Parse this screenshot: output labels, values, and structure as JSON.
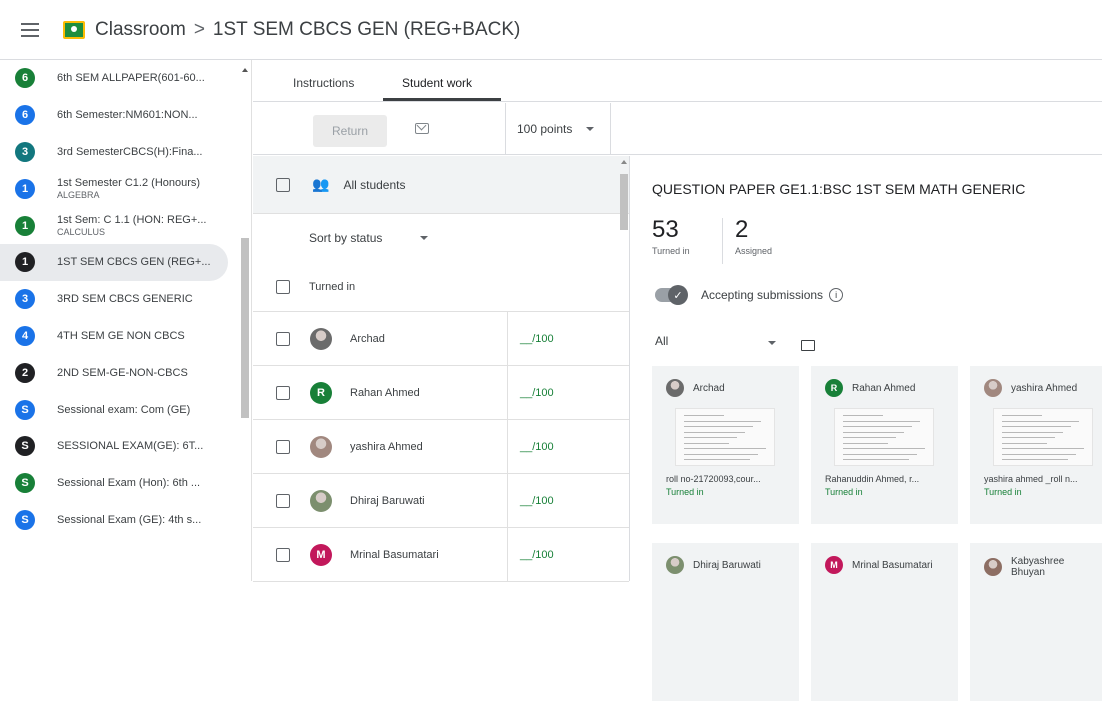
{
  "header": {
    "app_name": "Classroom",
    "separator": ">",
    "class_name": "1ST SEM CBCS GEN (REG+BACK)"
  },
  "sidebar": {
    "items": [
      {
        "badge": "6",
        "color": "#188038",
        "label": "6th SEM ALLPAPER(601-60...",
        "sub": ""
      },
      {
        "badge": "6",
        "color": "#1a73e8",
        "label": "6th Semester:NM601:NON...",
        "sub": ""
      },
      {
        "badge": "3",
        "color": "#12777e",
        "label": "3rd SemesterCBCS(H):Fina...",
        "sub": ""
      },
      {
        "badge": "1",
        "color": "#1a73e8",
        "label": "1st Semester C1.2 (Honours)",
        "sub": "ALGEBRA"
      },
      {
        "badge": "1",
        "color": "#188038",
        "label": "1st Sem: C 1.1 (HON: REG+...",
        "sub": "CALCULUS"
      },
      {
        "badge": "1",
        "color": "#202124",
        "label": "1ST SEM CBCS GEN (REG+...",
        "sub": "",
        "active": true
      },
      {
        "badge": "3",
        "color": "#1a73e8",
        "label": "3RD SEM CBCS GENERIC",
        "sub": ""
      },
      {
        "badge": "4",
        "color": "#1a73e8",
        "label": "4TH SEM GE NON CBCS",
        "sub": ""
      },
      {
        "badge": "2",
        "color": "#202124",
        "label": "2ND SEM-GE-NON-CBCS",
        "sub": ""
      },
      {
        "badge": "S",
        "color": "#1a73e8",
        "label": "Sessional exam: Com (GE)",
        "sub": ""
      },
      {
        "badge": "S",
        "color": "#202124",
        "label": "SESSIONAL EXAM(GE): 6T...",
        "sub": ""
      },
      {
        "badge": "S",
        "color": "#188038",
        "label": "Sessional Exam (Hon): 6th ...",
        "sub": ""
      },
      {
        "badge": "S",
        "color": "#1a73e8",
        "label": "Sessional Exam (GE): 4th s...",
        "sub": ""
      }
    ]
  },
  "tabs": {
    "instructions": "Instructions",
    "student_work": "Student work"
  },
  "toolbar": {
    "return_label": "Return",
    "points": "100 points"
  },
  "list": {
    "all_students": "All students",
    "sort_label": "Sort by status",
    "group_label": "Turned in",
    "students": [
      {
        "name": "Archad",
        "grade": "__/100",
        "avatar": "photo",
        "color": "#6b6b6b",
        "initial": ""
      },
      {
        "name": "Rahan Ahmed",
        "grade": "__/100",
        "avatar": "letter",
        "color": "#188038",
        "initial": "R"
      },
      {
        "name": "yashira Ahmed",
        "grade": "__/100",
        "avatar": "photo",
        "color": "#a1887f",
        "initial": ""
      },
      {
        "name": "Dhiraj Baruwati",
        "grade": "__/100",
        "avatar": "photo",
        "color": "#7c8f6e",
        "initial": ""
      },
      {
        "name": "Mrinal Basumatari",
        "grade": "__/100",
        "avatar": "letter",
        "color": "#c2185b",
        "initial": "M"
      }
    ]
  },
  "detail": {
    "title": "QUESTION PAPER GE1.1:BSC 1ST SEM MATH GENERIC",
    "turned_in_count": "53",
    "turned_in_label": "Turned in",
    "assigned_count": "2",
    "assigned_label": "Assigned",
    "accepting_label": "Accepting submissions",
    "filter_label": "All",
    "cards": [
      {
        "name": "Archad",
        "caption": "roll no-21720093,cour...",
        "status": "Turned in",
        "avatar": "photo",
        "color": "#6b6b6b",
        "initial": ""
      },
      {
        "name": "Rahan Ahmed",
        "caption": "Rahanuddin Ahmed, r...",
        "status": "Turned in",
        "avatar": "letter",
        "color": "#188038",
        "initial": "R"
      },
      {
        "name": "yashira Ahmed",
        "caption": "yashira ahmed _roll n...",
        "status": "Turned in",
        "avatar": "photo",
        "color": "#a1887f",
        "initial": ""
      },
      {
        "name": "Dhiraj Baruwati",
        "caption": "",
        "status": "",
        "avatar": "photo",
        "color": "#7c8f6e",
        "initial": ""
      },
      {
        "name": "Mrinal Basumatari",
        "caption": "",
        "status": "",
        "avatar": "letter",
        "color": "#c2185b",
        "initial": "M"
      },
      {
        "name": "Kabyashree Bhuyan",
        "caption": "",
        "status": "",
        "avatar": "photo",
        "color": "#8d6e63",
        "initial": ""
      }
    ]
  }
}
